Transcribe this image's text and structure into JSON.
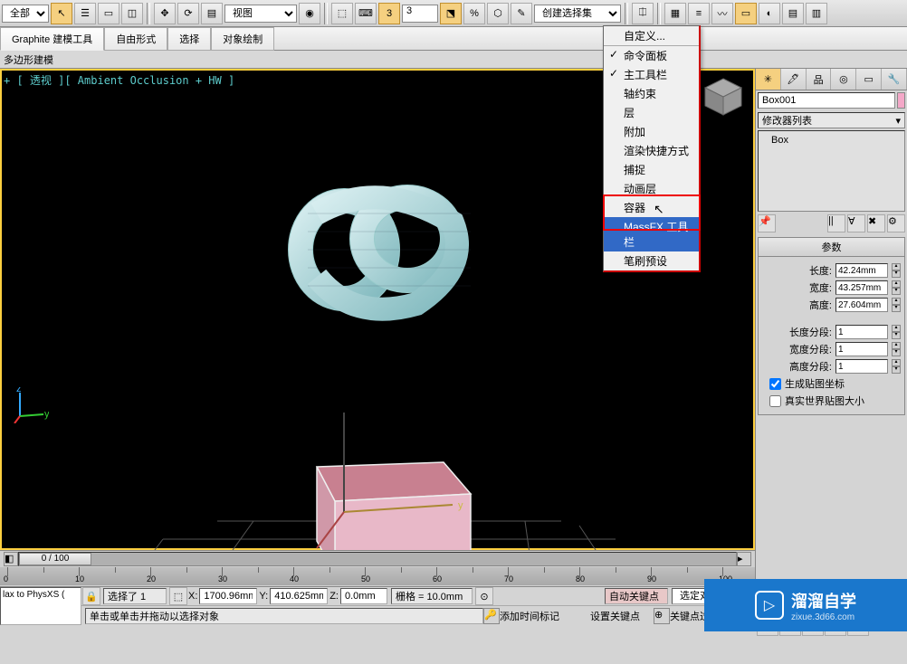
{
  "toolbar": {
    "combo_all": "全部",
    "view_combo": "视图",
    "angle_value": "3",
    "selset_combo": "创建选择集"
  },
  "ribbon": {
    "tab1": "Graphite 建模工具",
    "tab2": "自由形式",
    "tab3": "选择",
    "tab4": "对象绘制"
  },
  "sub_ribbon": "多边形建模",
  "viewport_label": "+ [ 透视 ][ Ambient Occlusion + HW ]",
  "context_menu": {
    "header": "自定义...",
    "items": [
      {
        "label": "命令面板",
        "checked": true
      },
      {
        "label": "主工具栏",
        "checked": true
      },
      {
        "label": "轴约束",
        "checked": false
      },
      {
        "label": "层",
        "checked": false
      },
      {
        "label": "附加",
        "checked": false
      },
      {
        "label": "渲染快捷方式",
        "checked": false
      },
      {
        "label": "捕捉",
        "checked": false
      },
      {
        "label": "动画层",
        "checked": false
      },
      {
        "label": "容器",
        "checked": false
      },
      {
        "label": "MassFX 工具栏",
        "checked": false,
        "highlighted": true
      },
      {
        "label": "笔刷预设",
        "checked": false
      }
    ]
  },
  "right_panel": {
    "obj_name": "Box001",
    "modifier_combo": "修改器列表",
    "stack_item": "Box",
    "rollout_title": "参数",
    "params": {
      "length_label": "长度:",
      "length_val": "42.24mm",
      "width_label": "宽度:",
      "width_val": "43.257mm",
      "height_label": "高度:",
      "height_val": "27.604mm",
      "lseg_label": "长度分段:",
      "lseg_val": "1",
      "wseg_label": "宽度分段:",
      "wseg_val": "1",
      "hseg_label": "高度分段:",
      "hseg_val": "1",
      "gen_map": "生成贴图坐标",
      "real_world": "真实世界贴图大小"
    }
  },
  "timeline": {
    "slider_label": "0 / 100"
  },
  "status": {
    "selected_label": "选择了 1",
    "x_label": "X:",
    "x_val": "1700.96mm",
    "y_label": "Y:",
    "y_val": "410.625mm",
    "z_label": "Z:",
    "z_val": "0.0mm",
    "grid_label": "栅格 = 10.0mm",
    "prompt": "单击或单击并拖动以选择对象",
    "add_time_tag": "添加时间标记",
    "auto_key": "自动关键点",
    "set_key": "设置关键点",
    "sel_obj": "选定对象",
    "key_filter": "关键点过滤器"
  },
  "maxscript": {
    "left_text": "lax to PhysXS ("
  },
  "axis": {
    "x": "x",
    "y": "y",
    "z": "z"
  },
  "watermark": {
    "title": "溜溜自学",
    "url": "zixue.3d66.com"
  }
}
